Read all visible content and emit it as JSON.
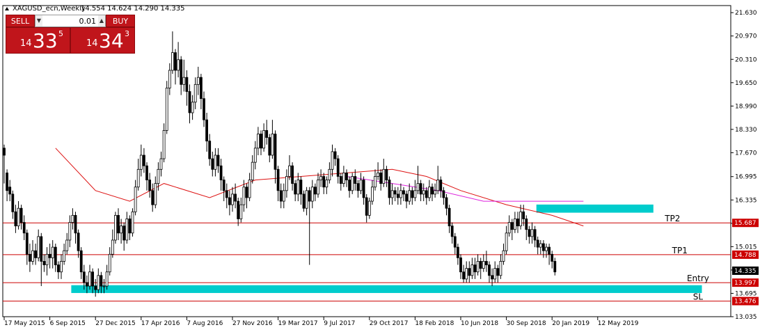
{
  "chart_data": {
    "type": "candlestick",
    "title": "XAGUSD_ecn,Weekly",
    "ohlc_info": "14.554 14.624 14.290 14.335",
    "ylim": [
      13.035,
      21.83
    ],
    "y_ticks": [
      "21.630",
      "20.970",
      "20.310",
      "19.650",
      "18.990",
      "18.330",
      "17.670",
      "16.995",
      "16.335",
      "15.675",
      "15.015",
      "14.355",
      "13.695",
      "13.035"
    ],
    "x_ticks": [
      "17 May 2015",
      "6 Sep 2015",
      "27 Dec 2015",
      "17 Apr 2016",
      "7 Aug 2016",
      "27 Nov 2016",
      "19 Mar 2017",
      "9 Jul 2017",
      "29 Oct 2017",
      "18 Feb 2018",
      "10 Jun 2018",
      "30 Sep 2018",
      "20 Jan 2019",
      "12 May 2019"
    ],
    "x_tick_index": [
      0,
      16,
      32,
      48,
      64,
      80,
      96,
      112,
      128,
      144,
      160,
      176,
      192,
      208
    ],
    "grid": false,
    "colors": {
      "bull": "#ffffff",
      "bear": "#000000",
      "wick": "#000000",
      "level": "#cc0000",
      "ma_red": "#dd1111",
      "ma_magenta": "#dd22dd",
      "zone": "#00cccc"
    },
    "candles": [
      [
        17.8,
        17.6,
        17.9,
        16.8
      ],
      [
        17.1,
        16.6,
        17.2,
        16.3
      ],
      [
        16.7,
        16.5,
        16.9,
        16.3
      ],
      [
        16.5,
        16.0,
        16.6,
        15.8
      ],
      [
        16.0,
        15.6,
        16.2,
        15.4
      ],
      [
        15.6,
        16.1,
        16.3,
        15.5
      ],
      [
        16.1,
        15.7,
        16.2,
        15.5
      ],
      [
        15.7,
        15.4,
        15.9,
        15.2
      ],
      [
        15.4,
        14.8,
        15.5,
        14.5
      ],
      [
        14.8,
        14.6,
        15.1,
        14.3
      ],
      [
        14.6,
        14.9,
        15.2,
        14.5
      ],
      [
        14.9,
        14.7,
        15.1,
        14.5
      ],
      [
        14.7,
        15.3,
        15.5,
        14.6
      ],
      [
        15.3,
        14.6,
        15.4,
        13.9
      ],
      [
        14.6,
        14.5,
        14.8,
        14.3
      ],
      [
        14.5,
        14.8,
        15.0,
        14.2
      ],
      [
        14.8,
        14.7,
        15.1,
        14.4
      ],
      [
        14.7,
        15.0,
        15.2,
        14.4
      ],
      [
        15.0,
        14.5,
        15.1,
        14.3
      ],
      [
        14.5,
        14.3,
        14.6,
        14.1
      ],
      [
        14.3,
        14.6,
        14.8,
        14.1
      ],
      [
        14.6,
        14.9,
        15.1,
        14.5
      ],
      [
        14.9,
        15.2,
        15.4,
        14.8
      ],
      [
        15.2,
        15.7,
        15.9,
        15.0
      ],
      [
        15.7,
        15.9,
        16.1,
        15.5
      ],
      [
        15.9,
        15.4,
        16.0,
        15.1
      ],
      [
        15.4,
        14.9,
        15.5,
        14.7
      ],
      [
        14.9,
        14.3,
        15.0,
        14.1
      ],
      [
        14.3,
        14.0,
        14.5,
        13.8
      ],
      [
        14.0,
        13.9,
        14.2,
        13.7
      ],
      [
        13.9,
        14.3,
        14.5,
        13.8
      ],
      [
        14.3,
        13.9,
        14.4,
        13.7
      ],
      [
        13.9,
        13.8,
        14.1,
        13.6
      ],
      [
        13.8,
        14.2,
        14.4,
        13.7
      ],
      [
        14.2,
        13.9,
        14.3,
        13.7
      ],
      [
        13.9,
        13.9,
        14.1,
        13.7
      ],
      [
        13.9,
        14.3,
        14.5,
        13.8
      ],
      [
        14.3,
        14.8,
        15.0,
        14.2
      ],
      [
        14.8,
        15.2,
        15.5,
        14.7
      ],
      [
        15.2,
        15.9,
        16.0,
        15.1
      ],
      [
        15.9,
        15.4,
        16.1,
        15.2
      ],
      [
        15.4,
        15.6,
        15.8,
        15.1
      ],
      [
        15.6,
        15.2,
        15.7,
        14.9
      ],
      [
        15.2,
        15.8,
        16.0,
        15.1
      ],
      [
        15.8,
        15.4,
        15.9,
        15.2
      ],
      [
        15.4,
        16.0,
        16.1,
        15.3
      ],
      [
        16.0,
        16.7,
        16.9,
        15.9
      ],
      [
        16.7,
        17.2,
        17.5,
        16.6
      ],
      [
        17.2,
        17.6,
        17.9,
        17.0
      ],
      [
        17.6,
        17.3,
        17.8,
        17.1
      ],
      [
        17.3,
        16.9,
        17.4,
        16.6
      ],
      [
        16.9,
        16.6,
        17.1,
        16.4
      ],
      [
        16.6,
        16.2,
        16.8,
        16.0
      ],
      [
        16.2,
        16.8,
        17.0,
        16.1
      ],
      [
        16.8,
        17.2,
        17.4,
        16.6
      ],
      [
        17.2,
        17.5,
        17.7,
        17.0
      ],
      [
        17.5,
        18.3,
        18.5,
        17.4
      ],
      [
        18.3,
        19.5,
        19.7,
        18.2
      ],
      [
        19.5,
        20.0,
        20.2,
        19.3
      ],
      [
        20.0,
        20.5,
        21.1,
        19.9
      ],
      [
        20.5,
        20.0,
        20.6,
        19.6
      ],
      [
        20.0,
        20.3,
        20.8,
        19.8
      ],
      [
        20.3,
        19.6,
        20.4,
        19.3
      ],
      [
        19.6,
        19.8,
        20.3,
        19.4
      ],
      [
        19.8,
        19.4,
        20.0,
        19.0
      ],
      [
        19.4,
        18.8,
        19.6,
        18.5
      ],
      [
        18.8,
        19.1,
        19.3,
        18.6
      ],
      [
        19.1,
        19.6,
        19.8,
        18.9
      ],
      [
        19.6,
        19.8,
        20.1,
        19.3
      ],
      [
        19.8,
        19.2,
        19.9,
        18.9
      ],
      [
        19.2,
        18.6,
        19.4,
        18.4
      ],
      [
        18.6,
        18.0,
        18.8,
        17.7
      ],
      [
        18.0,
        17.5,
        18.2,
        17.3
      ],
      [
        17.5,
        17.2,
        17.7,
        17.0
      ],
      [
        17.2,
        17.6,
        17.8,
        17.0
      ],
      [
        17.6,
        17.3,
        17.8,
        17.1
      ],
      [
        17.3,
        16.9,
        17.5,
        16.6
      ],
      [
        16.9,
        16.6,
        17.0,
        16.3
      ],
      [
        16.6,
        16.4,
        16.8,
        16.1
      ],
      [
        16.4,
        16.2,
        16.6,
        15.9
      ],
      [
        16.2,
        16.5,
        16.7,
        16.0
      ],
      [
        16.5,
        16.3,
        16.8,
        16.1
      ],
      [
        16.3,
        15.8,
        16.4,
        15.6
      ],
      [
        15.8,
        16.2,
        16.4,
        15.7
      ],
      [
        16.2,
        16.7,
        16.9,
        16.0
      ],
      [
        16.7,
        16.4,
        16.8,
        16.1
      ],
      [
        16.4,
        16.9,
        17.1,
        16.3
      ],
      [
        16.9,
        17.4,
        17.6,
        16.8
      ],
      [
        17.4,
        17.8,
        18.0,
        17.2
      ],
      [
        17.8,
        18.2,
        18.4,
        17.6
      ],
      [
        18.2,
        17.8,
        18.3,
        17.6
      ],
      [
        17.8,
        18.3,
        18.5,
        17.7
      ],
      [
        18.3,
        18.1,
        18.6,
        17.9
      ],
      [
        18.1,
        17.6,
        18.2,
        17.4
      ],
      [
        17.6,
        18.2,
        18.6,
        17.5
      ],
      [
        18.2,
        17.2,
        18.3,
        16.8
      ],
      [
        17.2,
        16.6,
        17.3,
        16.3
      ],
      [
        16.6,
        16.3,
        16.8,
        16.1
      ],
      [
        16.3,
        16.6,
        16.8,
        16.1
      ],
      [
        16.6,
        17.0,
        17.2,
        16.4
      ],
      [
        17.0,
        17.3,
        17.6,
        16.9
      ],
      [
        17.3,
        16.8,
        17.4,
        16.6
      ],
      [
        16.8,
        16.5,
        16.9,
        16.3
      ],
      [
        16.5,
        16.9,
        17.1,
        16.3
      ],
      [
        16.9,
        16.5,
        17.0,
        16.2
      ],
      [
        16.5,
        16.1,
        16.6,
        16.0
      ],
      [
        16.1,
        16.6,
        16.7,
        15.9
      ],
      [
        16.6,
        16.3,
        16.7,
        14.5
      ],
      [
        16.3,
        16.7,
        16.9,
        16.1
      ],
      [
        16.7,
        16.5,
        16.8,
        16.3
      ],
      [
        16.5,
        16.9,
        17.1,
        16.4
      ],
      [
        16.9,
        17.0,
        17.2,
        16.7
      ],
      [
        17.0,
        16.7,
        17.1,
        16.5
      ],
      [
        16.7,
        16.9,
        17.0,
        16.5
      ],
      [
        16.9,
        17.2,
        17.4,
        16.8
      ],
      [
        17.2,
        17.7,
        17.9,
        17.0
      ],
      [
        17.7,
        17.5,
        17.8,
        17.3
      ],
      [
        17.5,
        17.0,
        17.6,
        16.8
      ],
      [
        17.0,
        16.8,
        17.1,
        16.6
      ],
      [
        16.8,
        17.1,
        17.3,
        16.7
      ],
      [
        17.1,
        16.9,
        17.2,
        16.7
      ],
      [
        16.9,
        16.6,
        17.0,
        16.4
      ],
      [
        16.6,
        17.0,
        17.1,
        16.5
      ],
      [
        17.0,
        16.8,
        17.2,
        16.6
      ],
      [
        16.8,
        16.6,
        16.9,
        16.4
      ],
      [
        16.6,
        16.9,
        17.1,
        16.5
      ],
      [
        16.9,
        16.4,
        17.0,
        16.2
      ],
      [
        16.4,
        15.9,
        16.5,
        15.7
      ],
      [
        15.9,
        16.3,
        16.4,
        15.8
      ],
      [
        16.3,
        16.7,
        16.9,
        16.2
      ],
      [
        16.7,
        17.0,
        17.2,
        16.6
      ],
      [
        17.0,
        17.1,
        17.4,
        16.9
      ],
      [
        17.1,
        16.8,
        17.2,
        16.6
      ],
      [
        16.8,
        17.2,
        17.5,
        16.7
      ],
      [
        17.2,
        16.9,
        17.3,
        16.7
      ],
      [
        16.9,
        16.4,
        17.0,
        16.2
      ],
      [
        16.4,
        16.6,
        16.8,
        16.2
      ],
      [
        16.6,
        16.5,
        16.7,
        16.3
      ],
      [
        16.5,
        16.4,
        16.7,
        16.2
      ],
      [
        16.4,
        16.6,
        16.8,
        16.2
      ],
      [
        16.6,
        16.5,
        16.7,
        16.3
      ],
      [
        16.5,
        16.3,
        16.6,
        16.1
      ],
      [
        16.3,
        16.6,
        16.8,
        16.2
      ],
      [
        16.6,
        16.4,
        16.7,
        16.2
      ],
      [
        16.4,
        16.6,
        16.9,
        16.3
      ],
      [
        16.6,
        16.8,
        17.3,
        16.5
      ],
      [
        16.8,
        16.5,
        16.9,
        16.3
      ],
      [
        16.5,
        16.6,
        16.8,
        16.3
      ],
      [
        16.6,
        16.4,
        16.7,
        16.2
      ],
      [
        16.4,
        16.7,
        16.9,
        16.3
      ],
      [
        16.7,
        16.5,
        16.8,
        16.3
      ],
      [
        16.5,
        16.6,
        16.8,
        16.4
      ],
      [
        16.6,
        16.9,
        17.3,
        16.5
      ],
      [
        16.9,
        16.6,
        17.0,
        16.4
      ],
      [
        16.6,
        16.4,
        16.7,
        16.2
      ],
      [
        16.4,
        16.1,
        16.5,
        15.9
      ],
      [
        16.1,
        15.6,
        16.2,
        15.4
      ],
      [
        15.6,
        15.3,
        15.7,
        15.1
      ],
      [
        15.3,
        15.0,
        15.4,
        14.8
      ],
      [
        15.0,
        14.7,
        15.1,
        14.5
      ],
      [
        14.7,
        14.3,
        14.8,
        14.1
      ],
      [
        14.3,
        14.1,
        14.5,
        14.0
      ],
      [
        14.1,
        14.4,
        14.6,
        14.0
      ],
      [
        14.4,
        14.2,
        14.6,
        14.0
      ],
      [
        14.2,
        14.5,
        14.7,
        14.1
      ],
      [
        14.5,
        14.3,
        14.7,
        14.1
      ],
      [
        14.3,
        14.6,
        14.8,
        14.2
      ],
      [
        14.6,
        14.4,
        14.7,
        14.1
      ],
      [
        14.4,
        14.6,
        14.8,
        14.3
      ],
      [
        14.6,
        14.5,
        14.9,
        14.3
      ],
      [
        14.5,
        14.2,
        14.6,
        14.0
      ],
      [
        14.2,
        14.1,
        14.4,
        13.9
      ],
      [
        14.1,
        14.4,
        14.6,
        14.0
      ],
      [
        14.4,
        14.2,
        14.5,
        14.0
      ],
      [
        14.2,
        14.6,
        14.8,
        14.1
      ],
      [
        14.6,
        14.9,
        15.1,
        14.5
      ],
      [
        14.9,
        15.4,
        15.6,
        14.8
      ],
      [
        15.4,
        15.7,
        15.9,
        15.3
      ],
      [
        15.7,
        15.5,
        15.8,
        15.2
      ],
      [
        15.5,
        15.8,
        16.0,
        15.4
      ],
      [
        15.8,
        15.6,
        16.0,
        15.4
      ],
      [
        15.6,
        16.0,
        16.2,
        15.5
      ],
      [
        16.0,
        15.8,
        16.2,
        15.6
      ],
      [
        15.8,
        15.5,
        15.9,
        15.2
      ],
      [
        15.5,
        15.3,
        15.6,
        15.1
      ],
      [
        15.3,
        15.5,
        15.7,
        15.1
      ],
      [
        15.5,
        15.2,
        15.6,
        15.0
      ],
      [
        15.2,
        15.0,
        15.3,
        14.8
      ],
      [
        15.0,
        15.1,
        15.2,
        14.8
      ],
      [
        15.1,
        14.9,
        15.2,
        14.7
      ],
      [
        14.9,
        15.0,
        15.1,
        14.7
      ],
      [
        15.0,
        14.8,
        15.1,
        14.5
      ],
      [
        14.8,
        14.6,
        14.9,
        14.4
      ],
      [
        14.6,
        14.3,
        14.7,
        14.2
      ]
    ],
    "ma_red": [
      [
        17.8,
        18
      ],
      [
        16.6,
        32
      ],
      [
        16.3,
        44
      ],
      [
        16.8,
        56
      ],
      [
        16.4,
        72
      ],
      [
        16.9,
        88
      ],
      [
        17.0,
        104
      ],
      [
        17.1,
        120
      ],
      [
        17.2,
        136
      ],
      [
        17.0,
        148
      ],
      [
        16.6,
        160
      ],
      [
        16.2,
        176
      ],
      [
        15.9,
        192
      ],
      [
        15.6,
        203
      ]
    ],
    "ma_magenta": [
      [
        17.0,
        120
      ],
      [
        16.8,
        136
      ],
      [
        16.6,
        152
      ],
      [
        16.3,
        168
      ],
      [
        16.3,
        188
      ],
      [
        16.3,
        203
      ]
    ],
    "levels": [
      {
        "label": "TP2",
        "price": "15.687",
        "value": 15.687,
        "label_x": 0.92
      },
      {
        "label": "TP1",
        "price": "14.788",
        "value": 14.788,
        "label_x": 0.93
      },
      {
        "label": "Entry",
        "price": "13.997",
        "value": 13.997,
        "label_x": 0.955
      },
      {
        "label": "SL",
        "price": "13.476",
        "value": 13.476,
        "label_x": 0.955
      }
    ],
    "current_price": "14.335",
    "current_value": 14.335,
    "zones": [
      {
        "name": "resistance-zone",
        "from_index": 187,
        "to_index": 228,
        "low": 15.975,
        "high": 16.205
      },
      {
        "name": "support-zone",
        "from_index": 24,
        "to_index": 245,
        "low": 13.705,
        "high": 13.925
      }
    ]
  },
  "trade_panel": {
    "sell_label": "SELL",
    "buy_label": "BUY",
    "lot_value": "0.01",
    "sell_small": "14",
    "sell_big": "33",
    "sell_sup": "5",
    "buy_small": "14",
    "buy_big": "34",
    "buy_sup": "3"
  }
}
